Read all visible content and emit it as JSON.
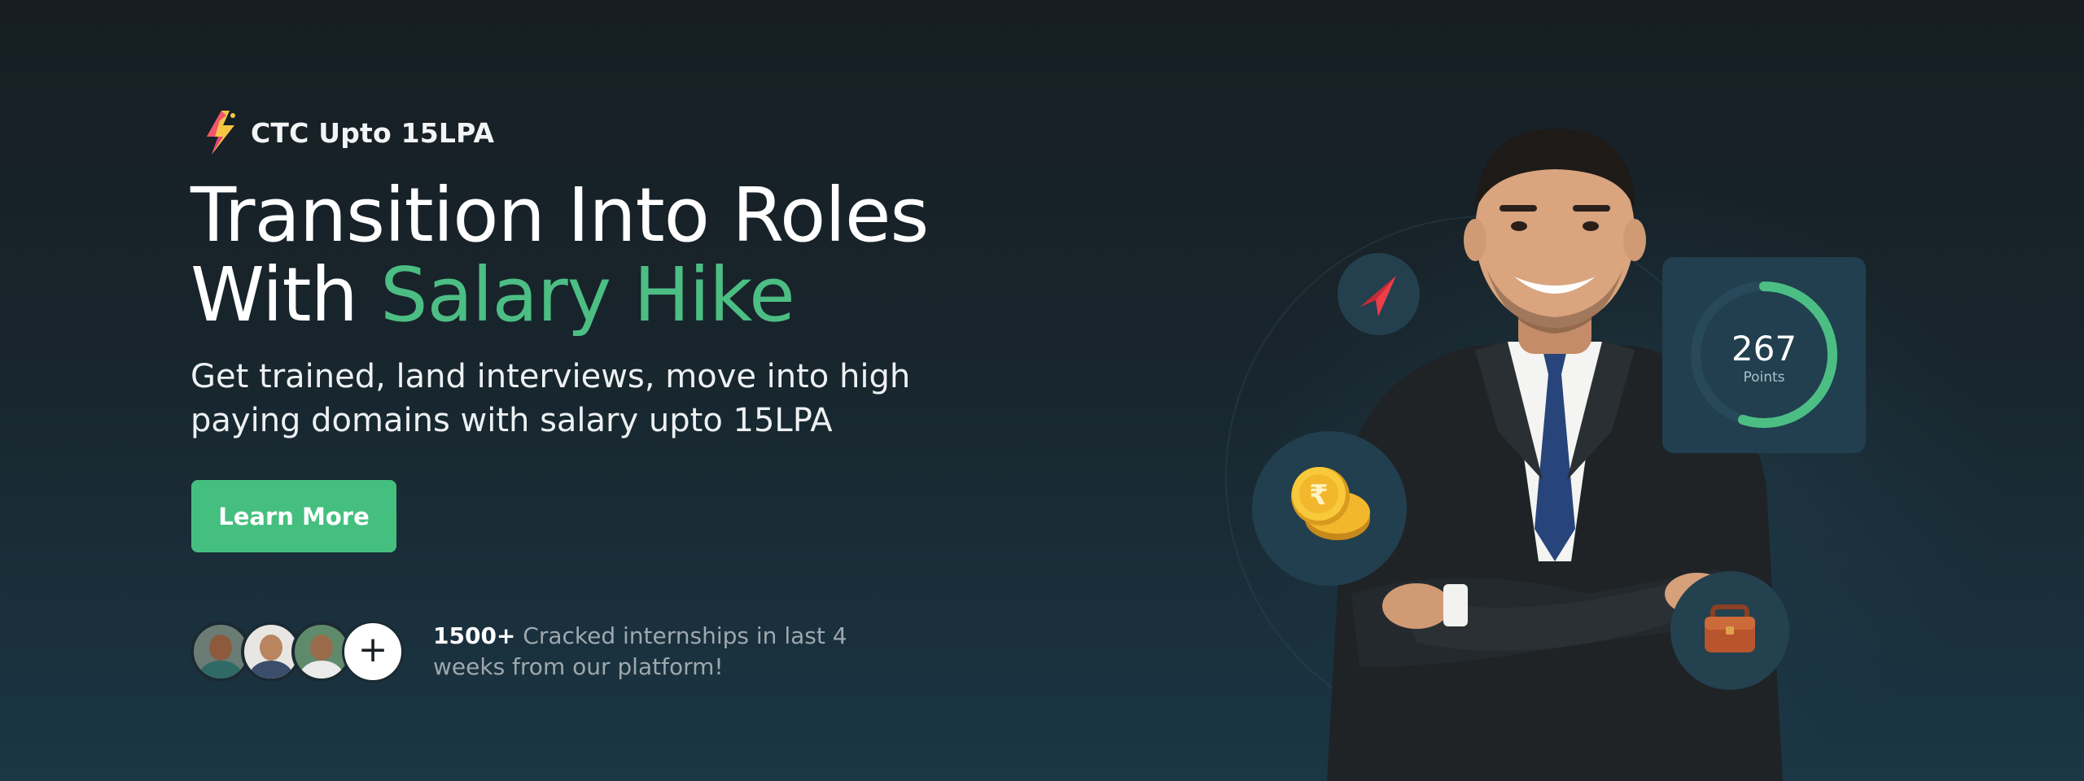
{
  "badge": {
    "text": "CTC Upto 15LPA",
    "icon": "lightning-bolt-icon"
  },
  "headline": {
    "line1": "Transition Into Roles",
    "line2_prefix": "With ",
    "line2_accent": "Salary Hike"
  },
  "subhead": {
    "line1": "Get trained, land interviews, move into high",
    "line2": "paying domains with salary upto 15LPA"
  },
  "cta": {
    "label": "Learn More"
  },
  "social_proof": {
    "count": "1500+",
    "text_line1": " Cracked internships in last 4",
    "text_line2": "weeks from our platform!",
    "plus_symbol": "+"
  },
  "points_card": {
    "value": "267",
    "label": "Points",
    "progress": 0.55
  },
  "icons": {
    "arrow": "arrow-cursor-icon",
    "coins": "rupee-coins-icon",
    "bag": "briefcase-icon"
  },
  "colors": {
    "accent": "#4cbe84",
    "button": "#45bf7f",
    "background_top": "#161e23",
    "background_bottom": "#1b3645",
    "card": "#213f4e"
  }
}
